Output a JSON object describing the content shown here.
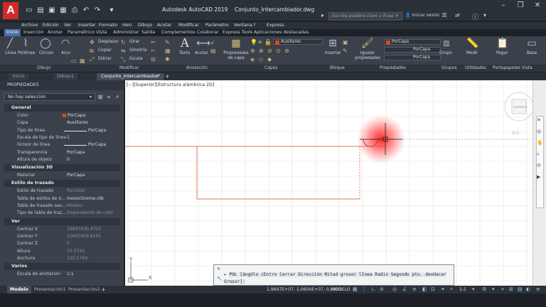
{
  "app": {
    "title": "Autodesk AutoCAD 2019",
    "filename": "Conjunto_Intercambiador.dwg",
    "search_placeholder": "Escriba palabra clave o frase",
    "signin": "Iniciar sesión",
    "logo_letter": "A",
    "accent": "#d12a2a"
  },
  "menu": [
    "Archivo",
    "Edición",
    "Ver",
    "Insertar",
    "Formato",
    "Herr.",
    "Dibujo",
    "Acotar",
    "Modificar",
    "Parámetro",
    "Ventana",
    "?",
    "Express"
  ],
  "ribbon_tabs": [
    "Inicio",
    "Inserción",
    "Anotar",
    "Paramétrico",
    "Vista",
    "Administrar",
    "Salida",
    "Complementos",
    "Colaborar",
    "Express Tools",
    "Aplicaciones destacadas"
  ],
  "ribbon": {
    "draw": {
      "line": "Línea",
      "polyline": "Polilínea",
      "circle": "Círculo",
      "arc": "Arco"
    },
    "modify": {
      "move": "Desplazar",
      "copy": "Copiar",
      "stretch": "Estirar",
      "rotate": "Girar",
      "mirror": "Simetría",
      "scale": "Escala"
    },
    "annotation": {
      "text": "Texto",
      "dimension": "Acotar"
    },
    "layers": {
      "layer_props": "Propiedades\nde capa",
      "current_layer": "Auxiliares"
    },
    "block": {
      "insert": "Insertar"
    },
    "properties": {
      "match": "Igualar\npropiedades",
      "bycapa1": "PorCapa",
      "bycapa2": "PorCapa",
      "bycapa3": "PorCapa"
    },
    "groups": {
      "group": "Grupo"
    },
    "utilities": {
      "measure": "Medir"
    },
    "clipboard": {
      "paste": "Pegar"
    },
    "view": {
      "base": "Base"
    },
    "panels": [
      "Dibujo",
      "Modificar",
      "Anotación",
      "Capas",
      "Bloque",
      "Propiedades",
      "Grupos",
      "Utilidades",
      "Portapapeles",
      "Vista"
    ]
  },
  "doc_tabs": [
    "Inicio",
    "Dibujo1",
    "Conjunto_Intercambiador*"
  ],
  "viewport_label": "[−][Superior][Estructura alámbrica 2D]",
  "properties": {
    "title": "PROPIEDADES",
    "selection": "No hay selección",
    "sections": {
      "general": "General",
      "viz3d": "Visualización 3D",
      "plotstyle": "Estilo de trazado",
      "view": "Ver",
      "misc": "Varios"
    },
    "general": [
      {
        "k": "Color",
        "v": "PorCapa"
      },
      {
        "k": "Capa",
        "v": "Auxiliares"
      },
      {
        "k": "Tipo de línea",
        "v": "PorCapa"
      },
      {
        "k": "Escala de tipo de línea",
        "v": "1"
      },
      {
        "k": "Grosor de línea",
        "v": "PorCapa"
      },
      {
        "k": "Transparencia",
        "v": "PorCapa"
      },
      {
        "k": "Altura de objeto",
        "v": "0"
      }
    ],
    "viz3d": [
      {
        "k": "Material",
        "v": "PorCapa"
      }
    ],
    "plotstyle": [
      {
        "k": "Estilo de trazado",
        "v": "PorColor"
      },
      {
        "k": "Tabla de estilos de tr...",
        "v": "monochrome.ctb"
      },
      {
        "k": "Tabla de trazado aso...",
        "v": "Modelo"
      },
      {
        "k": "Tipo de tabla de traz...",
        "v": "Dependiente de color"
      }
    ],
    "view": [
      {
        "k": "Centrar X",
        "v": "19697430.4755"
      },
      {
        "k": "Centrar Y",
        "v": "10605909.8191"
      },
      {
        "k": "Centrar Z",
        "v": "0"
      },
      {
        "k": "Altura",
        "v": "75.5742"
      },
      {
        "k": "Anchura",
        "v": "135.5764"
      }
    ],
    "misc": [
      {
        "k": "Escala de anotación",
        "v": "1:1"
      }
    ]
  },
  "command": {
    "prompt": "POL [ángUlo cEntro Cerrar Dirección Mitad grosor lÍnea Radio Segundo pto. desHacer",
    "prompt2": "Grosor]:"
  },
  "viewcube": {
    "label": "SUPERIOR",
    "wcs": "SCU"
  },
  "layout_tabs": [
    "Modelo",
    "Presentación1",
    "Presentación2"
  ],
  "status": {
    "coords": "1,9697E+07, 1,0604E+07, 0,0000",
    "model": "MODELO",
    "scale": "1:1"
  }
}
